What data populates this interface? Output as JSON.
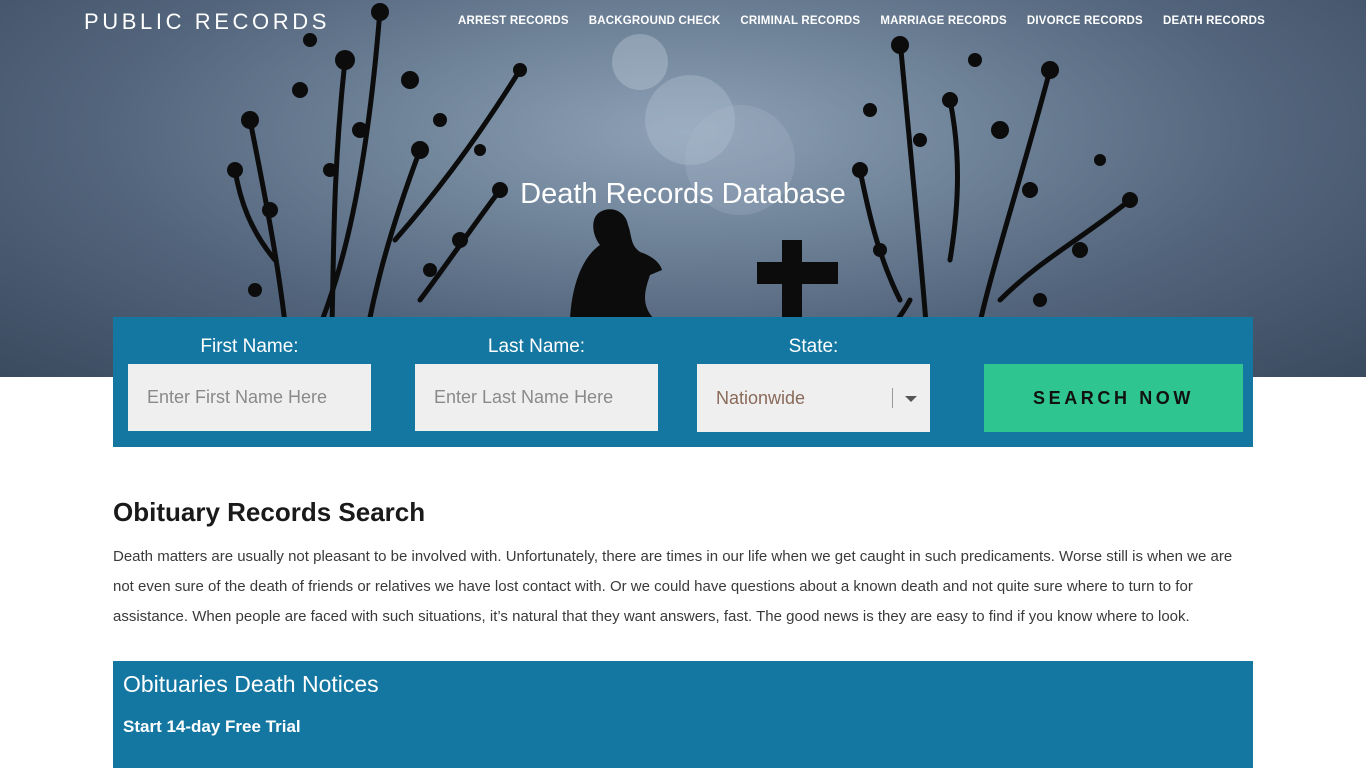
{
  "header": {
    "brand": "PUBLIC RECORDS",
    "nav": [
      {
        "label": "ARREST RECORDS"
      },
      {
        "label": "BACKGROUND CHECK"
      },
      {
        "label": "CRIMINAL RECORDS"
      },
      {
        "label": "MARRIAGE RECORDS"
      },
      {
        "label": "DIVORCE RECORDS"
      },
      {
        "label": "DEATH RECORDS"
      }
    ]
  },
  "hero": {
    "title": "Death Records Database"
  },
  "search": {
    "first_name_label": "First Name:",
    "first_name_placeholder": "Enter First Name Here",
    "last_name_label": "Last Name:",
    "last_name_placeholder": "Enter Last Name Here",
    "state_label": "State:",
    "state_value": "Nationwide",
    "button_label": "SEARCH NOW"
  },
  "content": {
    "title": "Obituary Records Search",
    "paragraph": "Death matters are usually not pleasant to be involved with. Unfortunately, there are times in our life when we get caught in such predicaments. Worse still is when we are not even sure of the death of friends or relatives we have lost contact with. Or we could have questions about a known death and not quite sure where to turn to for assistance. When people are faced with such situations, it’s natural that they want answers, fast. The good news is they are easy to find if you know where to look."
  },
  "notices": {
    "title": "Obituaries Death Notices",
    "trial_link": "Start 14-day Free Trial"
  },
  "colors": {
    "accent_blue": "#1477a2",
    "button_green": "#2ec591",
    "hero_sky": "#53657c"
  }
}
